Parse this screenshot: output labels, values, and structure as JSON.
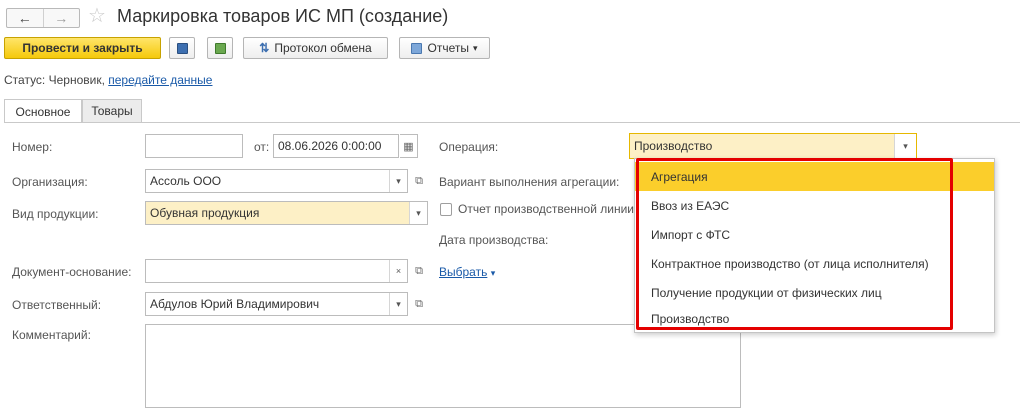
{
  "window": {
    "title": "Маркировка товаров ИС МП (создание)",
    "nav_back": "←",
    "nav_forward": "→",
    "favorite_icon": "star-icon"
  },
  "toolbar": {
    "post_close": "Провести и закрыть",
    "save_icon": "save-icon",
    "post_icon": "post-document-icon",
    "protocol": "Протокол обмена",
    "reports": "Отчеты",
    "reports_arrow": "▾"
  },
  "status": {
    "prefix": "Статус: Черновик, ",
    "link": "передайте данные"
  },
  "tabs": [
    {
      "label": "Основное",
      "active": true
    },
    {
      "label": "Товары",
      "active": false
    }
  ],
  "form": {
    "number_label": "Номер:",
    "number_value": "",
    "date_prefix": "от:",
    "date_value": "08.06.2026  0:00:00",
    "org_label": "Организация:",
    "org_value": "Ассоль ООО",
    "product_type_label": "Вид продукции:",
    "product_type_value": "Обувная продукция",
    "basis_doc_label": "Документ-основание:",
    "basis_doc_value": "",
    "select_link": "Выбрать",
    "select_arrow": "▾",
    "responsible_label": "Ответственный:",
    "responsible_value": "Абдулов Юрий Владимирович",
    "comment_label": "Комментарий:",
    "comment_value": "",
    "operation_label": "Операция:",
    "operation_value": "Производство",
    "aggregation_label": "Вариант выполнения агрегации:",
    "production_line_label": "Отчет производственной линии",
    "production_date_label": "Дата производства:"
  },
  "dropdown": {
    "options": [
      "Агрегация",
      "Ввоз из ЕАЭС",
      "Импорт с ФТС",
      "Контрактное производство (от лица исполнителя)",
      "Получение продукции от физических лиц",
      "Производство"
    ],
    "highlighted_index": 0
  },
  "colors": {
    "accent_yellow": "#f5c90b",
    "highlight_red": "#e40000",
    "link_blue": "#1a5aa8"
  }
}
